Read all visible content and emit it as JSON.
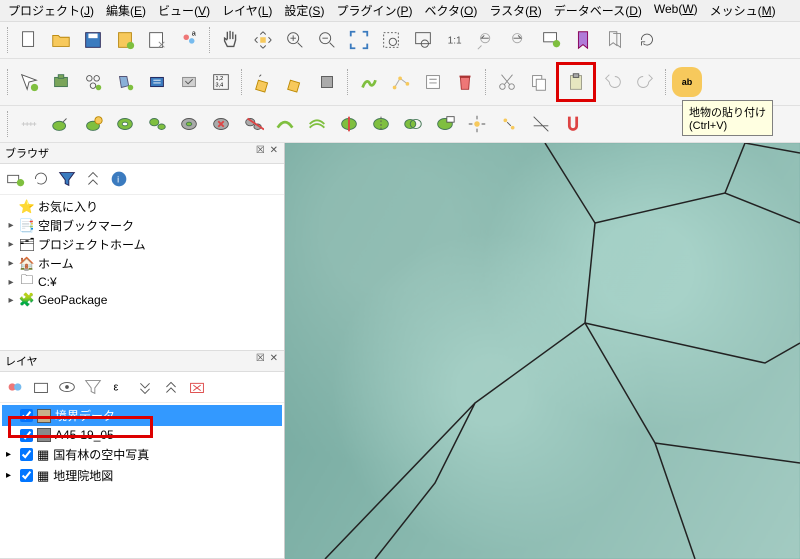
{
  "menu": {
    "project": "プロジェクト",
    "project_u": "J",
    "edit": "編集",
    "edit_u": "E",
    "view": "ビュー",
    "view_u": "V",
    "layer": "レイヤ",
    "layer_u": "L",
    "settings": "設定",
    "settings_u": "S",
    "plugin": "プラグイン",
    "plugin_u": "P",
    "vector": "ベクタ",
    "vector_u": "O",
    "raster": "ラスタ",
    "raster_u": "R",
    "database": "データベース",
    "database_u": "D",
    "web": "Web",
    "web_u": "W",
    "mesh": "メッシュ",
    "mesh_u": "M"
  },
  "tooltip": {
    "title": "地物の貼り付け",
    "shortcut": "(Ctrl+V)"
  },
  "panels": {
    "browser": "ブラウザ",
    "layers": "レイヤ",
    "close_min": "☒ ✕"
  },
  "browser_items": [
    {
      "arrow": "",
      "icon": "⭐",
      "label": "お気に入り",
      "name": "favorites"
    },
    {
      "arrow": "▸",
      "icon": "📑",
      "label": "空間ブックマーク",
      "name": "spatial-bookmarks"
    },
    {
      "arrow": "▸",
      "icon": "🗂",
      "label": "プロジェクトホーム",
      "name": "project-home"
    },
    {
      "arrow": "▸",
      "icon": "🏠",
      "label": "ホーム",
      "name": "home"
    },
    {
      "arrow": "▸",
      "icon": "🗀",
      "label": "C:¥",
      "name": "drive-c"
    },
    {
      "arrow": "▸",
      "icon": "🧩",
      "label": "GeoPackage",
      "name": "geopackage"
    }
  ],
  "layers": [
    {
      "arrow": "",
      "checked": true,
      "swatch": "#c9b08a",
      "label": "境界データ",
      "sel": true,
      "name": "layer-boundary",
      "icon": ""
    },
    {
      "arrow": "",
      "checked": true,
      "swatch": "#8a8a8a",
      "label": "A45-19_05",
      "sel": false,
      "name": "layer-a45",
      "icon": ""
    },
    {
      "arrow": "▸",
      "checked": true,
      "swatch": "",
      "label": "国有林の空中写真",
      "sel": false,
      "name": "layer-forest-photo",
      "icon": "▦"
    },
    {
      "arrow": "▸",
      "checked": true,
      "swatch": "",
      "label": "地理院地図",
      "sel": false,
      "name": "layer-gsi-map",
      "icon": "▦"
    }
  ]
}
